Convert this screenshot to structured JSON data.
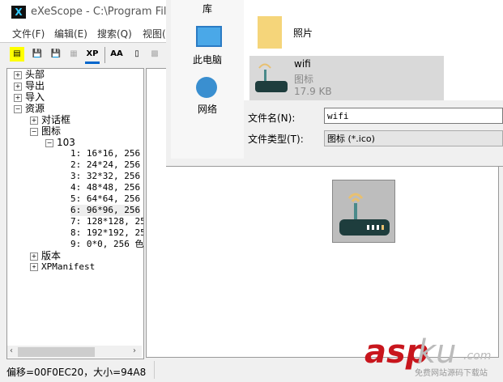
{
  "window": {
    "title": "eXeScope - C:\\Program Files"
  },
  "menu": [
    "文件(F)",
    "编辑(E)",
    "搜索(Q)",
    "视图("
  ],
  "toolbar": [
    "new",
    "save-export",
    "save-import",
    "copy",
    "XP",
    "AA",
    "binary",
    "image"
  ],
  "tree": {
    "top": [
      {
        "label": "头部",
        "expanded": false
      },
      {
        "label": "导出",
        "expanded": false
      },
      {
        "label": "导入",
        "expanded": false
      },
      {
        "label": "资源",
        "expanded": true
      }
    ],
    "resources": [
      {
        "label": "对话框",
        "expanded": false
      },
      {
        "label": "图标",
        "expanded": true
      }
    ],
    "icon_group": "103",
    "icons": [
      "1: 16*16, 256",
      "2: 24*24, 256",
      "3: 32*32, 256",
      "4: 48*48, 256",
      "5: 64*64, 256",
      "6: 96*96, 256",
      "7: 128*128, 25",
      "8: 192*192, 25",
      "9: 0*0, 256 色"
    ],
    "selected_index": 5,
    "bottom": [
      {
        "label": "版本"
      },
      {
        "label": "XPManifest"
      }
    ]
  },
  "status": "偏移=00F0EC20，大小=94A8",
  "dialog": {
    "nav": [
      "库",
      "此电脑",
      "网络"
    ],
    "files": [
      {
        "name": "照片"
      },
      {
        "name": "wifi",
        "type": "图标",
        "size": "17.9 KB",
        "selected": true
      }
    ],
    "filename_label": "文件名(N):",
    "filename": "wifi",
    "filetype_label": "文件类型(T):",
    "filetype": "图标 (*.ico)"
  },
  "watermark": {
    "a": "asp",
    "b": "ku",
    "c": ".com",
    "d": "免费网站源码下载站"
  }
}
